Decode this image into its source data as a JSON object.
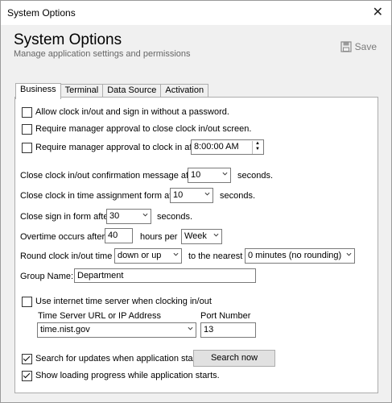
{
  "window": {
    "title": "System Options",
    "close_glyph": "✕"
  },
  "header": {
    "title": "System Options",
    "subtitle": "Manage application settings and permissions",
    "save_label": "Save"
  },
  "tabs": [
    "Business",
    "Terminal",
    "Data Source",
    "Activation"
  ],
  "business": {
    "allow_clock_label": "Allow clock in/out and sign in without a password.",
    "req_mgr_close_label": "Require manager approval to close clock in/out screen.",
    "req_mgr_clockin_label": "Require manager approval to clock in after",
    "clockin_time": "8:00:00 AM",
    "close_confirm_label": "Close clock in/out confirmation message after",
    "close_confirm_value": "10",
    "close_confirm_unit": "seconds.",
    "close_assign_label": "Close clock in time assignment form after",
    "close_assign_value": "10",
    "close_assign_unit": "seconds.",
    "close_signin_label": "Close sign in form after",
    "close_signin_value": "30",
    "close_signin_unit": "seconds.",
    "overtime_label": "Overtime occurs after",
    "overtime_value": "40",
    "overtime_per_label": "hours per",
    "overtime_period": "Week",
    "round_label": "Round clock in/out time",
    "round_direction": "down or up",
    "nearest_label": "to the nearest",
    "round_amount": "0 minutes (no rounding)",
    "group_label": "Group Name:",
    "group_value": "Department",
    "use_time_server_label": "Use internet time server when clocking in/out",
    "time_server_label": "Time Server URL or IP Address",
    "time_server_value": "time.nist.gov",
    "port_label": "Port Number",
    "port_value": "13",
    "search_updates_label": "Search for updates when application starts.",
    "search_now_label": "Search now",
    "show_progress_label": "Show loading progress while application starts."
  },
  "checks": {
    "allow_clock": false,
    "req_mgr_close": false,
    "req_mgr_clockin": false,
    "use_time_server": false,
    "search_updates": true,
    "show_progress": true
  }
}
